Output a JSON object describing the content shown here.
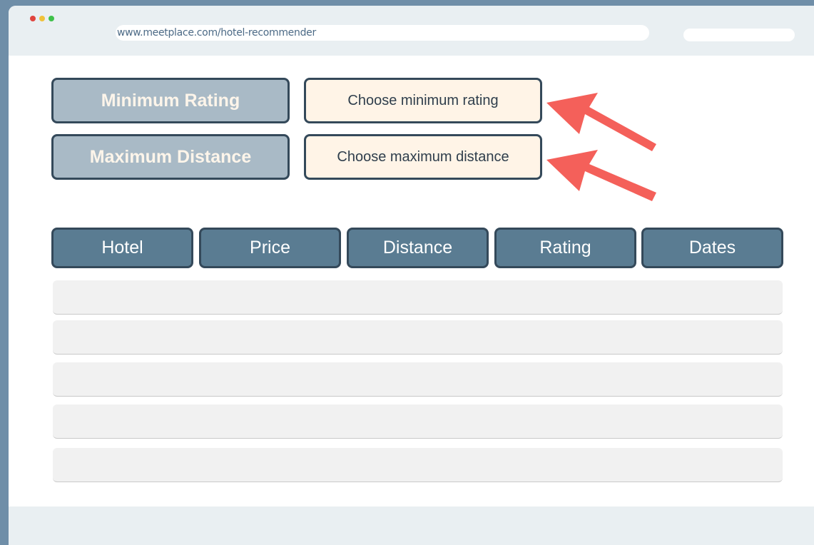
{
  "browser": {
    "url": "www.meetplace.com/hotel-recommender"
  },
  "filters": {
    "min_rating_label": "Minimum Rating",
    "min_rating_value": "Choose minimum rating",
    "max_distance_label": "Maximum Distance",
    "max_distance_value": "Choose maximum distance"
  },
  "table": {
    "columns": [
      "Hotel",
      "Price",
      "Distance",
      "Rating",
      "Dates"
    ],
    "row_count": 5
  },
  "colors": {
    "page_bg": "#6f8ea8",
    "label_bg": "#a9bac6",
    "select_bg": "#fff4e7",
    "header_bg": "#5a7c92",
    "border": "#34495a",
    "arrow": "#f4605a",
    "row_bg": "#f1f1f1"
  },
  "icons": {
    "window_controls": [
      "close-dot-icon",
      "minimize-dot-icon",
      "maximize-dot-icon"
    ],
    "annotation": "arrow-icon"
  }
}
